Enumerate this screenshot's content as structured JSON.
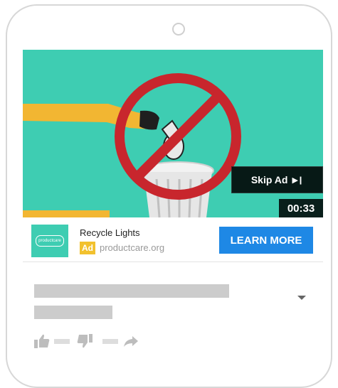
{
  "video": {
    "skip_label": "Skip Ad",
    "skip_icon": "skip-next-icon",
    "timer": "00:33"
  },
  "ad": {
    "logo_text": "productcare",
    "title": "Recycle Lights",
    "badge": "Ad",
    "domain": "productcare.org",
    "cta_label": "LEARN MORE"
  },
  "icons": {
    "dropdown": "chevron-down-icon",
    "like": "thumbs-up-icon",
    "dislike": "thumbs-down-icon",
    "share": "share-icon"
  },
  "colors": {
    "video_bg": "#3ecdb2",
    "cta": "#1e88e5",
    "ad_badge": "#f2c12e",
    "prohibit_sign": "#c8262d"
  }
}
